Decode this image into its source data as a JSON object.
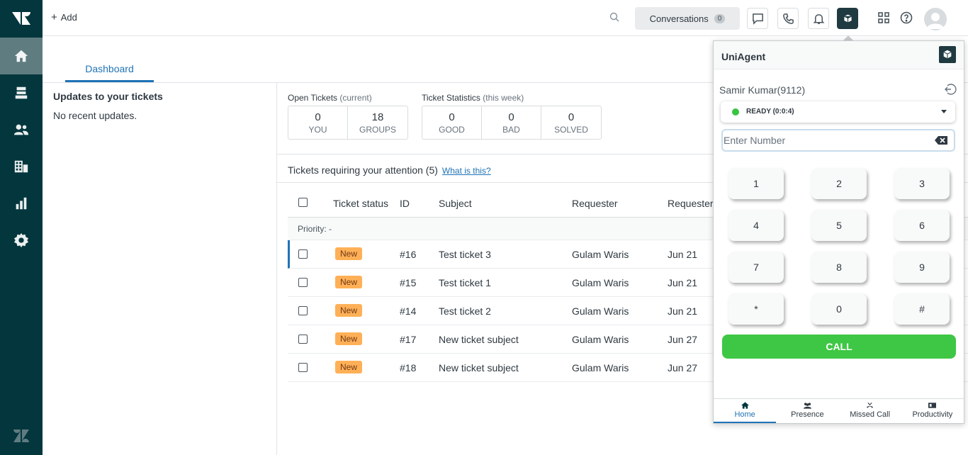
{
  "topbar": {
    "add_label": "Add",
    "conversations_label": "Conversations",
    "conversations_count": "0"
  },
  "tabs": {
    "dashboard": "Dashboard"
  },
  "updates": {
    "title": "Updates to your tickets",
    "empty": "No recent updates."
  },
  "open_tickets": {
    "title": "Open Tickets",
    "subtitle": "(current)",
    "boxes": [
      {
        "value": "0",
        "label": "YOU"
      },
      {
        "value": "18",
        "label": "GROUPS"
      }
    ]
  },
  "ticket_stats": {
    "title": "Ticket Statistics",
    "subtitle": "(this week)",
    "boxes": [
      {
        "value": "0",
        "label": "GOOD"
      },
      {
        "value": "0",
        "label": "BAD"
      },
      {
        "value": "0",
        "label": "SOLVED"
      }
    ]
  },
  "tickets": {
    "heading": "Tickets requiring your attention (5)",
    "help_link": "What is this?",
    "columns": [
      "Ticket status",
      "ID",
      "Subject",
      "Requester",
      "Requester"
    ],
    "priority_group": "Priority: -",
    "rows": [
      {
        "status": "New",
        "id": "#16",
        "subject": "Test ticket 3",
        "requester": "Gulam Waris",
        "date": "Jun 21"
      },
      {
        "status": "New",
        "id": "#15",
        "subject": "Test ticket 1",
        "requester": "Gulam Waris",
        "date": "Jun 21"
      },
      {
        "status": "New",
        "id": "#14",
        "subject": "Test ticket 2",
        "requester": "Gulam Waris",
        "date": "Jun 21"
      },
      {
        "status": "New",
        "id": "#17",
        "subject": "New ticket subject",
        "requester": "Gulam Waris",
        "date": "Jun 27"
      },
      {
        "status": "New",
        "id": "#18",
        "subject": "New ticket subject",
        "requester": "Gulam Waris",
        "date": "Jun 27"
      }
    ]
  },
  "uniagent": {
    "title": "UniAgent",
    "agent_name": "Samir Kumar(9112)",
    "status": "READY (0:0:4)",
    "number_placeholder": "Enter Number",
    "keys": [
      "1",
      "2",
      "3",
      "4",
      "5",
      "6",
      "7",
      "8",
      "9",
      "*",
      "0",
      "#"
    ],
    "call_label": "CALL",
    "footer": [
      {
        "label": "Home",
        "icon": "home-icon"
      },
      {
        "label": "Presence",
        "icon": "presence-icon"
      },
      {
        "label": "Missed Call",
        "icon": "missed-call-icon"
      },
      {
        "label": "Productivity",
        "icon": "productivity-icon"
      }
    ]
  },
  "colors": {
    "nav_bg": "#03363d",
    "accent": "#1f73b7",
    "new_badge": "#ffb057",
    "call_green": "#3ec744",
    "ready_green": "#38c440"
  }
}
